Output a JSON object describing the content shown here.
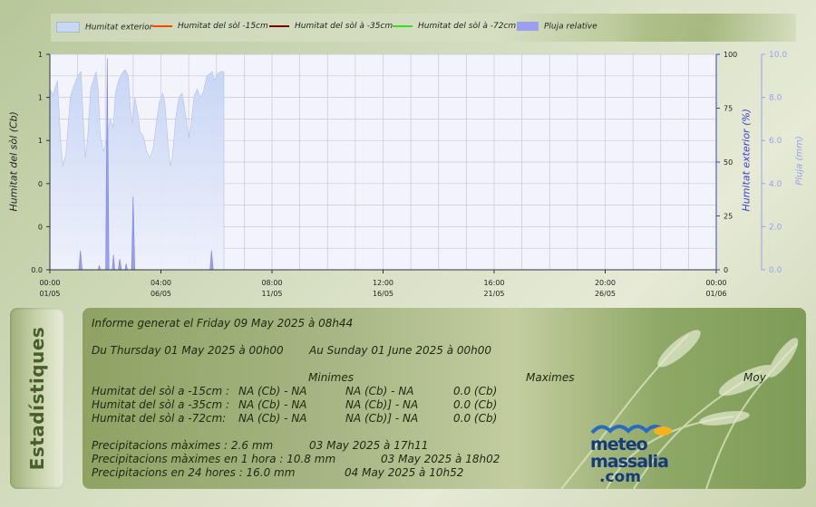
{
  "legend": [
    {
      "label": "Humitat exterior",
      "color": "#c8d8f0"
    },
    {
      "label": "Humitat del sòl -15cm",
      "color": "#ff4500"
    },
    {
      "label": "Humitat del sòl à -35cm",
      "color": "#7a0000"
    },
    {
      "label": "Humitat del sòl à -72cm",
      "color": "#33dd22"
    },
    {
      "label": "Pluja relative",
      "color": "#9aa0ee"
    }
  ],
  "chart_data": {
    "type": "area",
    "left_axis": {
      "label": "Humitat del sòl (Cb)",
      "ticks": [
        "1",
        "1",
        "1",
        "0",
        "0",
        "0.0"
      ]
    },
    "right_axis1": {
      "label": "Humitat exterior (%)",
      "ticks": [
        "100",
        "75",
        "50",
        "25",
        "0"
      ],
      "range": [
        0,
        100
      ],
      "color": "#3a3fd0"
    },
    "right_axis2": {
      "label": "Pluja (mm)",
      "ticks": [
        "10.0",
        "8.0",
        "6.0",
        "4.0",
        "2.0",
        "0.0"
      ],
      "range": [
        0,
        10
      ],
      "color": "#9aa0ee"
    },
    "x_ticks": [
      {
        "time": "00:00",
        "date": "01/05"
      },
      {
        "time": "04:00",
        "date": "06/05"
      },
      {
        "time": "08:00",
        "date": "11/05"
      },
      {
        "time": "12:00",
        "date": "16/05"
      },
      {
        "time": "16:00",
        "date": "21/05"
      },
      {
        "time": "20:00",
        "date": "26/05"
      },
      {
        "time": "00:00",
        "date": "01/06"
      }
    ],
    "x_range_days": [
      0,
      31
    ],
    "series": [
      {
        "name": "Humitat exterior",
        "points": [
          [
            0.0,
            84
          ],
          [
            0.15,
            81
          ],
          [
            0.35,
            88
          ],
          [
            0.5,
            60
          ],
          [
            0.6,
            48
          ],
          [
            0.75,
            54
          ],
          [
            0.95,
            80
          ],
          [
            1.1,
            85
          ],
          [
            1.3,
            90
          ],
          [
            1.45,
            92
          ],
          [
            1.55,
            70
          ],
          [
            1.65,
            52
          ],
          [
            1.75,
            60
          ],
          [
            1.9,
            84
          ],
          [
            2.05,
            89
          ],
          [
            2.15,
            92
          ],
          [
            2.25,
            84
          ],
          [
            2.35,
            62
          ],
          [
            2.5,
            55
          ],
          [
            2.65,
            60
          ],
          [
            2.8,
            70
          ],
          [
            2.95,
            66
          ],
          [
            3.05,
            82
          ],
          [
            3.2,
            88
          ],
          [
            3.35,
            91
          ],
          [
            3.5,
            93
          ],
          [
            3.65,
            90
          ],
          [
            3.75,
            75
          ],
          [
            3.85,
            68
          ],
          [
            3.95,
            80
          ],
          [
            4.1,
            72
          ],
          [
            4.2,
            64
          ],
          [
            4.35,
            62
          ],
          [
            4.5,
            55
          ],
          [
            4.65,
            52
          ],
          [
            4.8,
            56
          ],
          [
            4.95,
            68
          ],
          [
            5.1,
            78
          ],
          [
            5.25,
            82
          ],
          [
            5.35,
            78
          ],
          [
            5.5,
            58
          ],
          [
            5.6,
            48
          ],
          [
            5.7,
            52
          ],
          [
            5.85,
            70
          ],
          [
            6.0,
            80
          ],
          [
            6.15,
            82
          ],
          [
            6.3,
            73
          ],
          [
            6.45,
            61
          ],
          [
            6.55,
            66
          ],
          [
            6.7,
            80
          ],
          [
            6.85,
            84
          ],
          [
            7.0,
            80
          ],
          [
            7.15,
            83
          ],
          [
            7.3,
            90
          ],
          [
            7.45,
            91
          ],
          [
            7.55,
            92
          ],
          [
            7.65,
            88
          ],
          [
            7.8,
            91
          ],
          [
            7.95,
            92
          ],
          [
            8.1,
            92
          ]
        ]
      },
      {
        "name": "Pluja relative",
        "points": [
          [
            1.35,
            0
          ],
          [
            1.42,
            0.9
          ],
          [
            1.5,
            0
          ],
          [
            2.25,
            0
          ],
          [
            2.3,
            0.2
          ],
          [
            2.35,
            0
          ],
          [
            2.6,
            0
          ],
          [
            2.67,
            9.8
          ],
          [
            2.75,
            0
          ],
          [
            2.9,
            0
          ],
          [
            2.96,
            0.7
          ],
          [
            3.02,
            0
          ],
          [
            3.18,
            0
          ],
          [
            3.25,
            0.5
          ],
          [
            3.33,
            0
          ],
          [
            3.5,
            0
          ],
          [
            3.55,
            0.3
          ],
          [
            3.6,
            0
          ],
          [
            3.8,
            0
          ],
          [
            3.87,
            3.4
          ],
          [
            3.95,
            0
          ],
          [
            7.45,
            0
          ],
          [
            7.52,
            0.9
          ],
          [
            7.6,
            0
          ]
        ]
      }
    ]
  },
  "stats_tab": "Estadístiques",
  "stats": {
    "generated": "Informe generat el  Friday 09 May 2025 à 08h44",
    "range_from": "Du Thursday 01 May 2025 à 00h00",
    "range_to": "Au Sunday 01 June 2025 à 00h00",
    "col_min": "Minimes",
    "col_max": "Maximes",
    "col_avg": "Moy",
    "rows": [
      {
        "label": "Humitat del sòl a -15cm :",
        "min": "NA (Cb) - NA",
        "max": "NA (Cb) - NA",
        "avg": "0.0 (Cb)"
      },
      {
        "label": "Humitat del sòl a -35cm :",
        "min": "NA (Cb) - NA",
        "max": "NA (Cb)] - NA",
        "avg": "0.0 (Cb)"
      },
      {
        "label": "Humitat del sòl a -72cm:",
        "min": "NA (Cb) - NA",
        "max": "NA (Cb)] - NA",
        "avg": "0.0 (Cb)"
      }
    ],
    "precip": [
      {
        "label": "Precipitacions màximes : 2.6 mm",
        "date": "03 May 2025 à 17h11"
      },
      {
        "label": "Precipitacions màximes en 1 hora : 10.8 mm",
        "date": "03 May 2025 à 18h02"
      },
      {
        "label": "Precipitacions en 24 hores : 16.0 mm",
        "date": "04 May 2025 à 10h52"
      }
    ]
  },
  "logo": {
    "line1": "meteo",
    "line2": "massalia",
    "line3": ".com"
  }
}
